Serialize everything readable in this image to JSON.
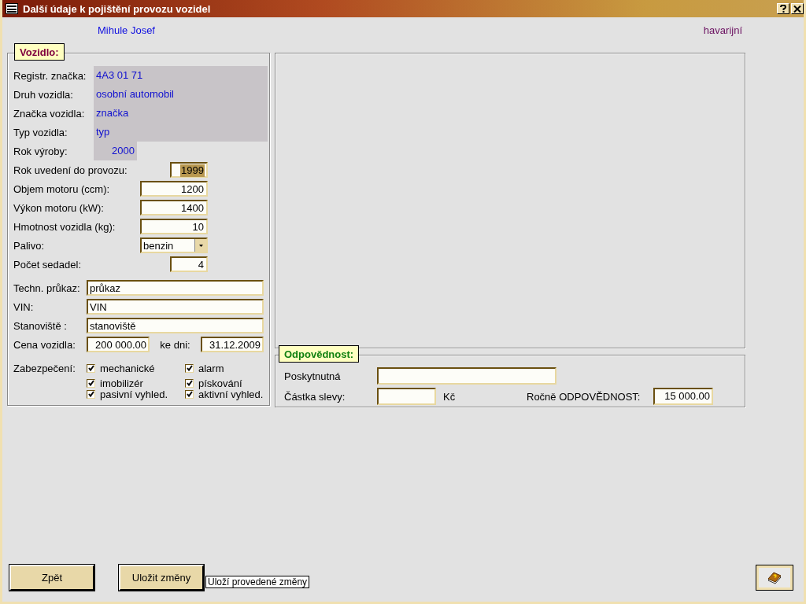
{
  "window": {
    "title": "Další údaje k pojištění provozu vozidel"
  },
  "header": {
    "client": "Mihule  Josef",
    "insurance_type": "havarijní"
  },
  "vehicle": {
    "legend": "Vozidlo:",
    "readonly_rows": [
      {
        "label": "Registr. značka:",
        "value": "4A3 01 71",
        "kind": "text"
      },
      {
        "label": "Druh vozidla:",
        "value": "osobní automobil",
        "kind": "text"
      },
      {
        "label": "Značka vozidla:",
        "value": "značka",
        "kind": "text"
      },
      {
        "label": "Typ vozidla:",
        "value": "typ",
        "kind": "text"
      },
      {
        "label": "Rok výroby:",
        "value": "2000",
        "kind": "number"
      }
    ],
    "inputs": [
      {
        "label": "Rok uvedení do provozu:",
        "value": "1999",
        "kind": "short",
        "text_selected": true
      },
      {
        "label": "Objem motoru (ccm):",
        "value": "1200",
        "kind": "number",
        "text_selected": false
      },
      {
        "label": "Výkon motoru (kW):",
        "value": "1400",
        "kind": "number",
        "text_selected": false
      },
      {
        "label": "Hmotnost vozidla (kg):",
        "value": "10",
        "kind": "number",
        "text_selected": false
      },
      {
        "label": "Palivo:",
        "value": "benzin",
        "kind": "select"
      },
      {
        "label": "Počet sedadel:",
        "value": "4",
        "kind": "short",
        "text_selected": false
      }
    ],
    "text_fields": [
      {
        "label": "Techn. průkaz:",
        "value": "průkaz"
      },
      {
        "label": "VIN:",
        "value": "VIN"
      },
      {
        "label": "Stanoviště :",
        "value": "stanoviště"
      }
    ],
    "price": {
      "label": "Cena vozidla:",
      "value": "200 000.00",
      "date_label": "ke dni:",
      "date": "31.12.2009"
    },
    "security": {
      "label": "Zabezpečení:",
      "options": [
        {
          "label": "mechanické",
          "checked": true
        },
        {
          "label": "alarm",
          "checked": true
        },
        {
          "label": "imobilizér",
          "checked": true
        },
        {
          "label": "pískování",
          "checked": true
        },
        {
          "label": "pasivní vyhled.",
          "checked": true
        },
        {
          "label": "aktivní vyhled.",
          "checked": true
        }
      ]
    }
  },
  "liability": {
    "legend": "Odpovědnost:",
    "granted_label": "Poskytnutná",
    "discount_label": "Částka slevy:",
    "discount_unit": "Kč",
    "annual_label": "Ročně ODPOVĚDNOST:",
    "annual_value": "15 000.00"
  },
  "buttons": {
    "back": "Zpět",
    "save": "Uložit změny",
    "save_tooltip": "Uloží provedené změny"
  }
}
